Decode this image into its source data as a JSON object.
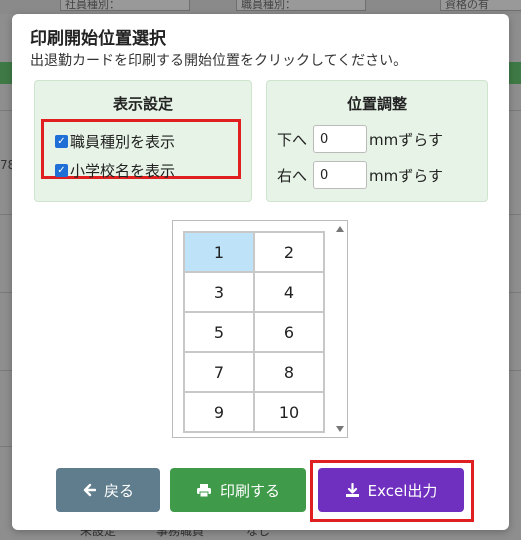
{
  "background": {
    "header_cells": [
      "社員種別：",
      "職員種別：",
      "資格の有"
    ],
    "left_text": "78",
    "bottom_texts": [
      "未設定",
      "事務職員",
      "なし"
    ]
  },
  "modal": {
    "title": "印刷開始位置選択",
    "description": "出退勤カードを印刷する開始位置をクリックしてください。"
  },
  "display_settings": {
    "title": "表示設定",
    "options": [
      {
        "label": "職員種別を表示",
        "checked": true
      },
      {
        "label": "小学校名を表示",
        "checked": true
      }
    ]
  },
  "position_adjust": {
    "title": "位置調整",
    "down_label": "下へ",
    "down_value": "0",
    "right_label": "右へ",
    "right_value": "0",
    "unit_text": "mmずらす"
  },
  "grid": {
    "rows": [
      [
        "1",
        "2"
      ],
      [
        "3",
        "4"
      ],
      [
        "5",
        "6"
      ],
      [
        "7",
        "8"
      ],
      [
        "9",
        "10"
      ]
    ],
    "selected": "1"
  },
  "buttons": {
    "back": "戻る",
    "print": "印刷する",
    "excel": "Excel出力"
  },
  "colors": {
    "panel_bg": "#e6f3e6",
    "back": "#5f7d8c",
    "print": "#3f9a4a",
    "excel": "#6f2fbf",
    "highlight": "#e02020",
    "selected_cell": "#bee3f8"
  }
}
